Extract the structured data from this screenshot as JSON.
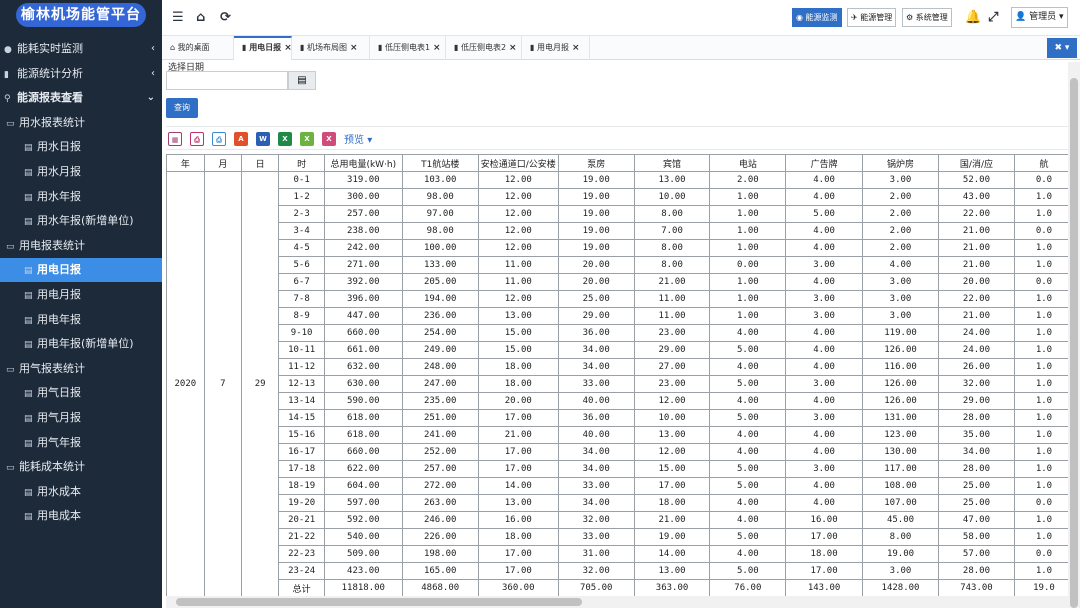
{
  "app": {
    "title": "榆林机场能管平台"
  },
  "sidebar": {
    "items": [
      {
        "label": "能耗实时监测",
        "icon": "globe-icon",
        "level": 1,
        "arrow": "chevron-left"
      },
      {
        "label": "能源统计分析",
        "icon": "bar-chart-icon",
        "level": 1,
        "arrow": "chevron-left"
      },
      {
        "label": "能源报表查看",
        "icon": "search-icon",
        "level": 1,
        "arrow": "chevron-down"
      },
      {
        "label": "用水报表统计",
        "icon": "folder-open-icon",
        "level": 2
      },
      {
        "label": "用水日报",
        "icon": "file-icon",
        "level": 3
      },
      {
        "label": "用水月报",
        "icon": "file-icon",
        "level": 3
      },
      {
        "label": "用水年报",
        "icon": "file-icon",
        "level": 3
      },
      {
        "label": "用水年报(新增单位)",
        "icon": "file-icon",
        "level": 3
      },
      {
        "label": "用电报表统计",
        "icon": "folder-open-icon",
        "level": 2
      },
      {
        "label": "用电日报",
        "icon": "file-icon",
        "level": 3,
        "active": true
      },
      {
        "label": "用电月报",
        "icon": "file-icon",
        "level": 3
      },
      {
        "label": "用电年报",
        "icon": "file-icon",
        "level": 3
      },
      {
        "label": "用电年报(新增单位)",
        "icon": "file-icon",
        "level": 3
      },
      {
        "label": "用气报表统计",
        "icon": "folder-open-icon",
        "level": 2
      },
      {
        "label": "用气日报",
        "icon": "file-icon",
        "level": 3
      },
      {
        "label": "用气月报",
        "icon": "file-icon",
        "level": 3
      },
      {
        "label": "用气年报",
        "icon": "file-icon",
        "level": 3
      },
      {
        "label": "能耗成本统计",
        "icon": "folder-open-icon",
        "level": 2
      },
      {
        "label": "用水成本",
        "icon": "file-icon",
        "level": 3
      },
      {
        "label": "用电成本",
        "icon": "file-icon",
        "level": 3
      }
    ]
  },
  "topbar": {
    "buttons": [
      {
        "label": "能源监测",
        "icon": "dashboard-icon",
        "primary": true
      },
      {
        "label": "能源管理",
        "icon": "plane-icon",
        "primary": false
      },
      {
        "label": "系统管理",
        "icon": "gear-icon",
        "primary": false
      }
    ],
    "user_label": "管理员"
  },
  "tabs": [
    {
      "label": "我的桌面",
      "icon": "home-icon",
      "closable": false,
      "active": false
    },
    {
      "label": "用电日报",
      "icon": "bookmark-icon",
      "closable": true,
      "active": true
    },
    {
      "label": "机场布局图",
      "icon": "bookmark-icon",
      "closable": true,
      "active": false
    },
    {
      "label": "低压侧电表1",
      "icon": "bookmark-icon",
      "closable": true,
      "active": false
    },
    {
      "label": "低压侧电表2",
      "icon": "bookmark-icon",
      "closable": true,
      "active": false
    },
    {
      "label": "用电月报",
      "icon": "bookmark-icon",
      "closable": true,
      "active": false
    }
  ],
  "filter": {
    "date_label": "选择日期",
    "date_value": "",
    "query_label": "查询"
  },
  "toolbar": {
    "preview_label": "预览"
  },
  "colors": {
    "sidebar_bg": "#1c2a3a",
    "accent": "#2f6fc6",
    "active_item": "#3c8de6",
    "logo_bg": "#3566d6"
  },
  "table": {
    "headers": [
      "年",
      "月",
      "日",
      "时",
      "总用电量(kW·h)",
      "T1航站楼",
      "安检通道口/公安楼",
      "泵房",
      "宾馆",
      "电站",
      "广告牌",
      "锅炉房",
      "国/消/应",
      "航"
    ],
    "year": "2020",
    "month": "7",
    "day": "29",
    "rows": [
      [
        "0-1",
        "319.00",
        "103.00",
        "12.00",
        "19.00",
        "13.00",
        "2.00",
        "4.00",
        "3.00",
        "52.00",
        "0.0"
      ],
      [
        "1-2",
        "300.00",
        "98.00",
        "12.00",
        "19.00",
        "10.00",
        "1.00",
        "4.00",
        "2.00",
        "43.00",
        "1.0"
      ],
      [
        "2-3",
        "257.00",
        "97.00",
        "12.00",
        "19.00",
        "8.00",
        "1.00",
        "5.00",
        "2.00",
        "22.00",
        "1.0"
      ],
      [
        "3-4",
        "238.00",
        "98.00",
        "12.00",
        "19.00",
        "7.00",
        "1.00",
        "4.00",
        "2.00",
        "21.00",
        "0.0"
      ],
      [
        "4-5",
        "242.00",
        "100.00",
        "12.00",
        "19.00",
        "8.00",
        "1.00",
        "4.00",
        "2.00",
        "21.00",
        "1.0"
      ],
      [
        "5-6",
        "271.00",
        "133.00",
        "11.00",
        "20.00",
        "8.00",
        "0.00",
        "3.00",
        "4.00",
        "21.00",
        "1.0"
      ],
      [
        "6-7",
        "392.00",
        "205.00",
        "11.00",
        "20.00",
        "21.00",
        "1.00",
        "4.00",
        "3.00",
        "20.00",
        "0.0"
      ],
      [
        "7-8",
        "396.00",
        "194.00",
        "12.00",
        "25.00",
        "11.00",
        "1.00",
        "3.00",
        "3.00",
        "22.00",
        "1.0"
      ],
      [
        "8-9",
        "447.00",
        "236.00",
        "13.00",
        "29.00",
        "11.00",
        "1.00",
        "3.00",
        "3.00",
        "21.00",
        "1.0"
      ],
      [
        "9-10",
        "660.00",
        "254.00",
        "15.00",
        "36.00",
        "23.00",
        "4.00",
        "4.00",
        "119.00",
        "24.00",
        "1.0"
      ],
      [
        "10-11",
        "661.00",
        "249.00",
        "15.00",
        "34.00",
        "29.00",
        "5.00",
        "4.00",
        "126.00",
        "24.00",
        "1.0"
      ],
      [
        "11-12",
        "632.00",
        "248.00",
        "18.00",
        "34.00",
        "27.00",
        "4.00",
        "4.00",
        "116.00",
        "26.00",
        "1.0"
      ],
      [
        "12-13",
        "630.00",
        "247.00",
        "18.00",
        "33.00",
        "23.00",
        "5.00",
        "3.00",
        "126.00",
        "32.00",
        "1.0"
      ],
      [
        "13-14",
        "590.00",
        "235.00",
        "20.00",
        "40.00",
        "12.00",
        "4.00",
        "4.00",
        "126.00",
        "29.00",
        "1.0"
      ],
      [
        "14-15",
        "618.00",
        "251.00",
        "17.00",
        "36.00",
        "10.00",
        "5.00",
        "3.00",
        "131.00",
        "28.00",
        "1.0"
      ],
      [
        "15-16",
        "618.00",
        "241.00",
        "21.00",
        "40.00",
        "13.00",
        "4.00",
        "4.00",
        "123.00",
        "35.00",
        "1.0"
      ],
      [
        "16-17",
        "660.00",
        "252.00",
        "17.00",
        "34.00",
        "12.00",
        "4.00",
        "4.00",
        "130.00",
        "34.00",
        "1.0"
      ],
      [
        "17-18",
        "622.00",
        "257.00",
        "17.00",
        "34.00",
        "15.00",
        "5.00",
        "3.00",
        "117.00",
        "28.00",
        "1.0"
      ],
      [
        "18-19",
        "604.00",
        "272.00",
        "14.00",
        "33.00",
        "17.00",
        "5.00",
        "4.00",
        "108.00",
        "25.00",
        "1.0"
      ],
      [
        "19-20",
        "597.00",
        "263.00",
        "13.00",
        "34.00",
        "18.00",
        "4.00",
        "4.00",
        "107.00",
        "25.00",
        "0.0"
      ],
      [
        "20-21",
        "592.00",
        "246.00",
        "16.00",
        "32.00",
        "21.00",
        "4.00",
        "16.00",
        "45.00",
        "47.00",
        "1.0"
      ],
      [
        "21-22",
        "540.00",
        "226.00",
        "18.00",
        "33.00",
        "19.00",
        "5.00",
        "17.00",
        "8.00",
        "58.00",
        "1.0"
      ],
      [
        "22-23",
        "509.00",
        "198.00",
        "17.00",
        "31.00",
        "14.00",
        "4.00",
        "18.00",
        "19.00",
        "57.00",
        "0.0"
      ],
      [
        "23-24",
        "423.00",
        "165.00",
        "17.00",
        "32.00",
        "13.00",
        "5.00",
        "17.00",
        "3.00",
        "28.00",
        "1.0"
      ]
    ],
    "total": [
      "总计",
      "11818.00",
      "4868.00",
      "360.00",
      "705.00",
      "363.00",
      "76.00",
      "143.00",
      "1428.00",
      "743.00",
      "19.0"
    ]
  }
}
